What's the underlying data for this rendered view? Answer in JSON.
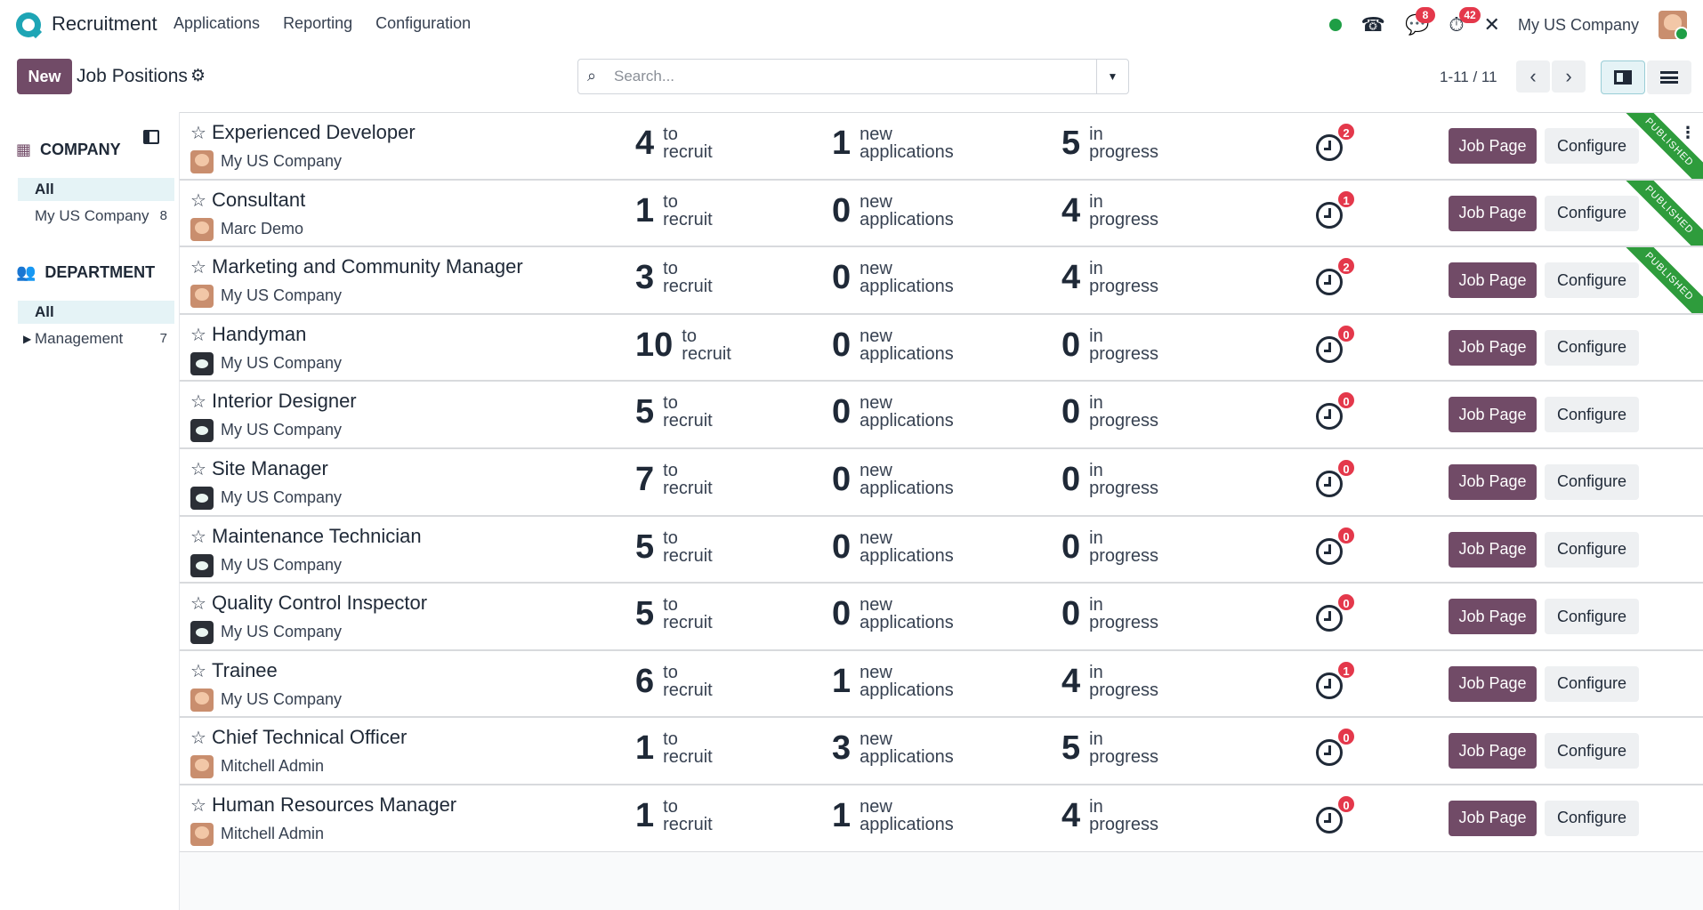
{
  "navbar": {
    "app_title": "Recruitment",
    "menu": [
      "Applications",
      "Reporting",
      "Configuration"
    ],
    "messages_badge": "8",
    "activities_badge": "42",
    "company": "My US Company"
  },
  "control": {
    "new_label": "New",
    "title": "Job Positions",
    "search_placeholder": "Search...",
    "pager": "1-11 / 11"
  },
  "sidebar": {
    "company_title": "COMPANY",
    "company_items": [
      {
        "label": "All",
        "count": ""
      },
      {
        "label": "My US Company",
        "count": "8"
      }
    ],
    "department_title": "DEPARTMENT",
    "department_items": [
      {
        "label": "All",
        "count": ""
      },
      {
        "label": "Management",
        "count": "7"
      }
    ]
  },
  "labels": {
    "to_recruit": "to\nrecruit",
    "new_applications": "new\napplications",
    "in_progress": "in\nprogress",
    "job_page": "Job Page",
    "configure": "Configure",
    "published": "PUBLISHED"
  },
  "jobs": [
    {
      "title": "Experienced Developer",
      "company": "My US Company",
      "avatar": "face",
      "to_recruit": "4",
      "new_applications": "1",
      "in_progress": "5",
      "activities": "2",
      "published": true
    },
    {
      "title": "Consultant",
      "company": "Marc Demo",
      "avatar": "face",
      "to_recruit": "1",
      "new_applications": "0",
      "in_progress": "4",
      "activities": "1",
      "published": true
    },
    {
      "title": "Marketing and Community Manager",
      "company": "My US Company",
      "avatar": "face",
      "to_recruit": "3",
      "new_applications": "0",
      "in_progress": "4",
      "activities": "2",
      "published": true
    },
    {
      "title": "Handyman",
      "company": "My US Company",
      "avatar": "bot",
      "to_recruit": "10",
      "new_applications": "0",
      "in_progress": "0",
      "activities": "0",
      "published": false
    },
    {
      "title": "Interior Designer",
      "company": "My US Company",
      "avatar": "bot",
      "to_recruit": "5",
      "new_applications": "0",
      "in_progress": "0",
      "activities": "0",
      "published": false
    },
    {
      "title": "Site Manager",
      "company": "My US Company",
      "avatar": "bot",
      "to_recruit": "7",
      "new_applications": "0",
      "in_progress": "0",
      "activities": "0",
      "published": false
    },
    {
      "title": "Maintenance Technician",
      "company": "My US Company",
      "avatar": "bot",
      "to_recruit": "5",
      "new_applications": "0",
      "in_progress": "0",
      "activities": "0",
      "published": false
    },
    {
      "title": "Quality Control Inspector",
      "company": "My US Company",
      "avatar": "bot",
      "to_recruit": "5",
      "new_applications": "0",
      "in_progress": "0",
      "activities": "0",
      "published": false
    },
    {
      "title": "Trainee",
      "company": "My US Company",
      "avatar": "face",
      "to_recruit": "6",
      "new_applications": "1",
      "in_progress": "4",
      "activities": "1",
      "published": false
    },
    {
      "title": "Chief Technical Officer",
      "company": "Mitchell Admin",
      "avatar": "face",
      "to_recruit": "1",
      "new_applications": "3",
      "in_progress": "5",
      "activities": "0",
      "published": false
    },
    {
      "title": "Human Resources Manager",
      "company": "Mitchell Admin",
      "avatar": "face",
      "to_recruit": "1",
      "new_applications": "1",
      "in_progress": "4",
      "activities": "0",
      "published": false
    }
  ]
}
